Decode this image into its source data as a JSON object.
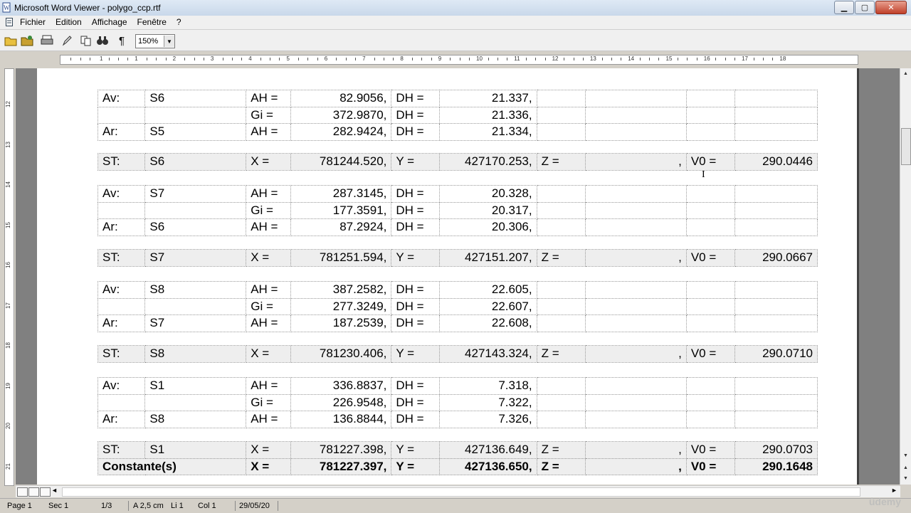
{
  "window": {
    "title": "Microsoft Word Viewer - polygo_ccp.rtf"
  },
  "menu": [
    "Fichier",
    "Edition",
    "Affichage",
    "Fenêtre",
    "?"
  ],
  "toolbar": {
    "zoom": "150%"
  },
  "ruler": {
    "labels": [
      "1",
      "1",
      "2",
      "3",
      "4",
      "5",
      "6",
      "7",
      "8",
      "9",
      "10",
      "11",
      "12",
      "13",
      "14",
      "15",
      "16",
      "17",
      "18"
    ]
  },
  "vruler": {
    "labels": [
      "12",
      "13",
      "14",
      "15",
      "16",
      "17",
      "18",
      "19",
      "20",
      "21"
    ]
  },
  "blocks": [
    {
      "kind": "obs",
      "rows": [
        [
          "Av:",
          "S6",
          "AH =",
          "82.9056,",
          "DH =",
          "21.337,",
          "",
          "",
          "",
          ""
        ],
        [
          "",
          "",
          "Gi =",
          "372.9870,",
          "DH =",
          "21.336,",
          "",
          "",
          "",
          ""
        ],
        [
          "Ar:",
          "S5",
          "AH =",
          "282.9424,",
          "DH =",
          "21.334,",
          "",
          "",
          "",
          ""
        ]
      ]
    },
    {
      "kind": "st",
      "rows": [
        [
          "ST:",
          "S6",
          "X =",
          "781244.520,",
          "Y =",
          "427170.253,",
          "Z =",
          ",",
          "V0 =",
          "290.0446"
        ]
      ]
    },
    {
      "kind": "obs",
      "rows": [
        [
          "Av:",
          "S7",
          "AH =",
          "287.3145,",
          "DH =",
          "20.328,",
          "",
          "",
          "",
          ""
        ],
        [
          "",
          "",
          "Gi =",
          "177.3591,",
          "DH =",
          "20.317,",
          "",
          "",
          "",
          ""
        ],
        [
          "Ar:",
          "S6",
          "AH =",
          "87.2924,",
          "DH =",
          "20.306,",
          "",
          "",
          "",
          ""
        ]
      ]
    },
    {
      "kind": "st",
      "rows": [
        [
          "ST:",
          "S7",
          "X =",
          "781251.594,",
          "Y =",
          "427151.207,",
          "Z =",
          ",",
          "V0 =",
          "290.0667"
        ]
      ]
    },
    {
      "kind": "obs",
      "rows": [
        [
          "Av:",
          "S8",
          "AH =",
          "387.2582,",
          "DH =",
          "22.605,",
          "",
          "",
          "",
          ""
        ],
        [
          "",
          "",
          "Gi =",
          "277.3249,",
          "DH =",
          "22.607,",
          "",
          "",
          "",
          ""
        ],
        [
          "Ar:",
          "S7",
          "AH =",
          "187.2539,",
          "DH =",
          "22.608,",
          "",
          "",
          "",
          ""
        ]
      ]
    },
    {
      "kind": "st",
      "rows": [
        [
          "ST:",
          "S8",
          "X =",
          "781230.406,",
          "Y =",
          "427143.324,",
          "Z =",
          ",",
          "V0 =",
          "290.0710"
        ]
      ]
    },
    {
      "kind": "obs",
      "rows": [
        [
          "Av:",
          "S1",
          "AH =",
          "336.8837,",
          "DH =",
          "7.318,",
          "",
          "",
          "",
          ""
        ],
        [
          "",
          "",
          "Gi =",
          "226.9548,",
          "DH =",
          "7.322,",
          "",
          "",
          "",
          ""
        ],
        [
          "Ar:",
          "S8",
          "AH =",
          "136.8844,",
          "DH =",
          "7.326,",
          "",
          "",
          "",
          ""
        ]
      ]
    },
    {
      "kind": "st",
      "rows": [
        [
          "ST:",
          "S1",
          "X =",
          "781227.398,",
          "Y =",
          "427136.649,",
          "Z =",
          ",",
          "V0 =",
          "290.0703"
        ],
        [
          "Constante(s)",
          "",
          "X =",
          "781227.397,",
          "Y =",
          "427136.650,",
          "Z =",
          ",",
          "V0 =",
          "290.1648"
        ]
      ]
    }
  ],
  "status": {
    "page": "Page 1",
    "sec": "Sec 1",
    "pages": "1/3",
    "at": "A 2,5 cm",
    "li": "Li 1",
    "col": "Col 1",
    "date": "29/05/20"
  },
  "watermark": "ûdemy"
}
